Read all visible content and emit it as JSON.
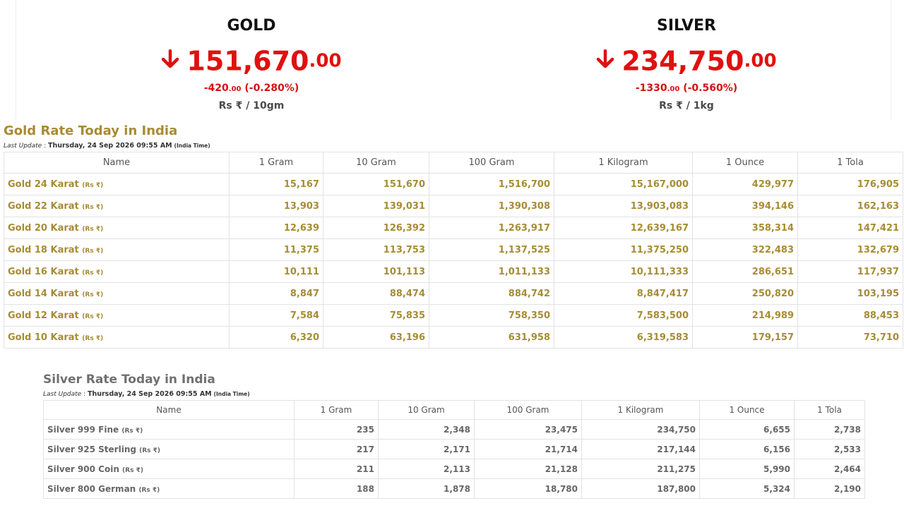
{
  "ticker": {
    "gold": {
      "name": "GOLD",
      "price_main": "151,670",
      "price_dec": ".00",
      "change_main": "-420",
      "change_dec": ".00",
      "change_pct": "(-0.280%)",
      "unit": "Rs ₹ / 10gm",
      "direction": "down",
      "color": "#e01010"
    },
    "silver": {
      "name": "SILVER",
      "price_main": "234,750",
      "price_dec": ".00",
      "change_main": "-1330",
      "change_dec": ".00",
      "change_pct": "(-0.560%)",
      "unit": "Rs ₹ / 1kg",
      "direction": "down",
      "color": "#e01010"
    }
  },
  "gold_table": {
    "title": "Gold Rate Today in India",
    "update_label": "Last Update",
    "update_sep": " : ",
    "update_time": "Thursday, 24 Sep 2026 09:55 AM",
    "update_tz": "(India Time)",
    "columns": [
      "Name",
      "1 Gram",
      "10 Gram",
      "100 Gram",
      "1 Kilogram",
      "1 Ounce",
      "1 Tola"
    ],
    "currency_tag": "(Rs ₹)",
    "rows": [
      {
        "name": "Gold 24 Karat",
        "values": [
          "15,167",
          "151,670",
          "1,516,700",
          "15,167,000",
          "429,977",
          "176,905"
        ]
      },
      {
        "name": "Gold 22 Karat",
        "values": [
          "13,903",
          "139,031",
          "1,390,308",
          "13,903,083",
          "394,146",
          "162,163"
        ]
      },
      {
        "name": "Gold 20 Karat",
        "values": [
          "12,639",
          "126,392",
          "1,263,917",
          "12,639,167",
          "358,314",
          "147,421"
        ]
      },
      {
        "name": "Gold 18 Karat",
        "values": [
          "11,375",
          "113,753",
          "1,137,525",
          "11,375,250",
          "322,483",
          "132,679"
        ]
      },
      {
        "name": "Gold 16 Karat",
        "values": [
          "10,111",
          "101,113",
          "1,011,133",
          "10,111,333",
          "286,651",
          "117,937"
        ]
      },
      {
        "name": "Gold 14 Karat",
        "values": [
          "8,847",
          "88,474",
          "884,742",
          "8,847,417",
          "250,820",
          "103,195"
        ]
      },
      {
        "name": "Gold 12 Karat",
        "values": [
          "7,584",
          "75,835",
          "758,350",
          "7,583,500",
          "214,989",
          "88,453"
        ]
      },
      {
        "name": "Gold 10 Karat",
        "values": [
          "6,320",
          "63,196",
          "631,958",
          "6,319,583",
          "179,157",
          "73,710"
        ]
      }
    ],
    "text_color": "#a68c34"
  },
  "silver_table": {
    "title": "Silver Rate Today in India",
    "update_label": "Last Update",
    "update_sep": " : ",
    "update_time": "Thursday, 24 Sep 2026 09:55 AM",
    "update_tz": "(India Time)",
    "columns": [
      "Name",
      "1 Gram",
      "10 Gram",
      "100 Gram",
      "1 Kilogram",
      "1 Ounce",
      "1 Tola"
    ],
    "currency_tag": "(Rs ₹)",
    "rows": [
      {
        "name": "Silver 999 Fine",
        "values": [
          "235",
          "2,348",
          "23,475",
          "234,750",
          "6,655",
          "2,738"
        ]
      },
      {
        "name": "Silver 925 Sterling",
        "values": [
          "217",
          "2,171",
          "21,714",
          "217,144",
          "6,156",
          "2,533"
        ]
      },
      {
        "name": "Silver 900 Coin",
        "values": [
          "211",
          "2,113",
          "21,128",
          "211,275",
          "5,990",
          "2,464"
        ]
      },
      {
        "name": "Silver 800 German",
        "values": [
          "188",
          "1,878",
          "18,780",
          "187,800",
          "5,324",
          "2,190"
        ]
      }
    ],
    "text_color": "#666666"
  },
  "icons": {
    "down_arrow": "arrow-down-icon"
  }
}
